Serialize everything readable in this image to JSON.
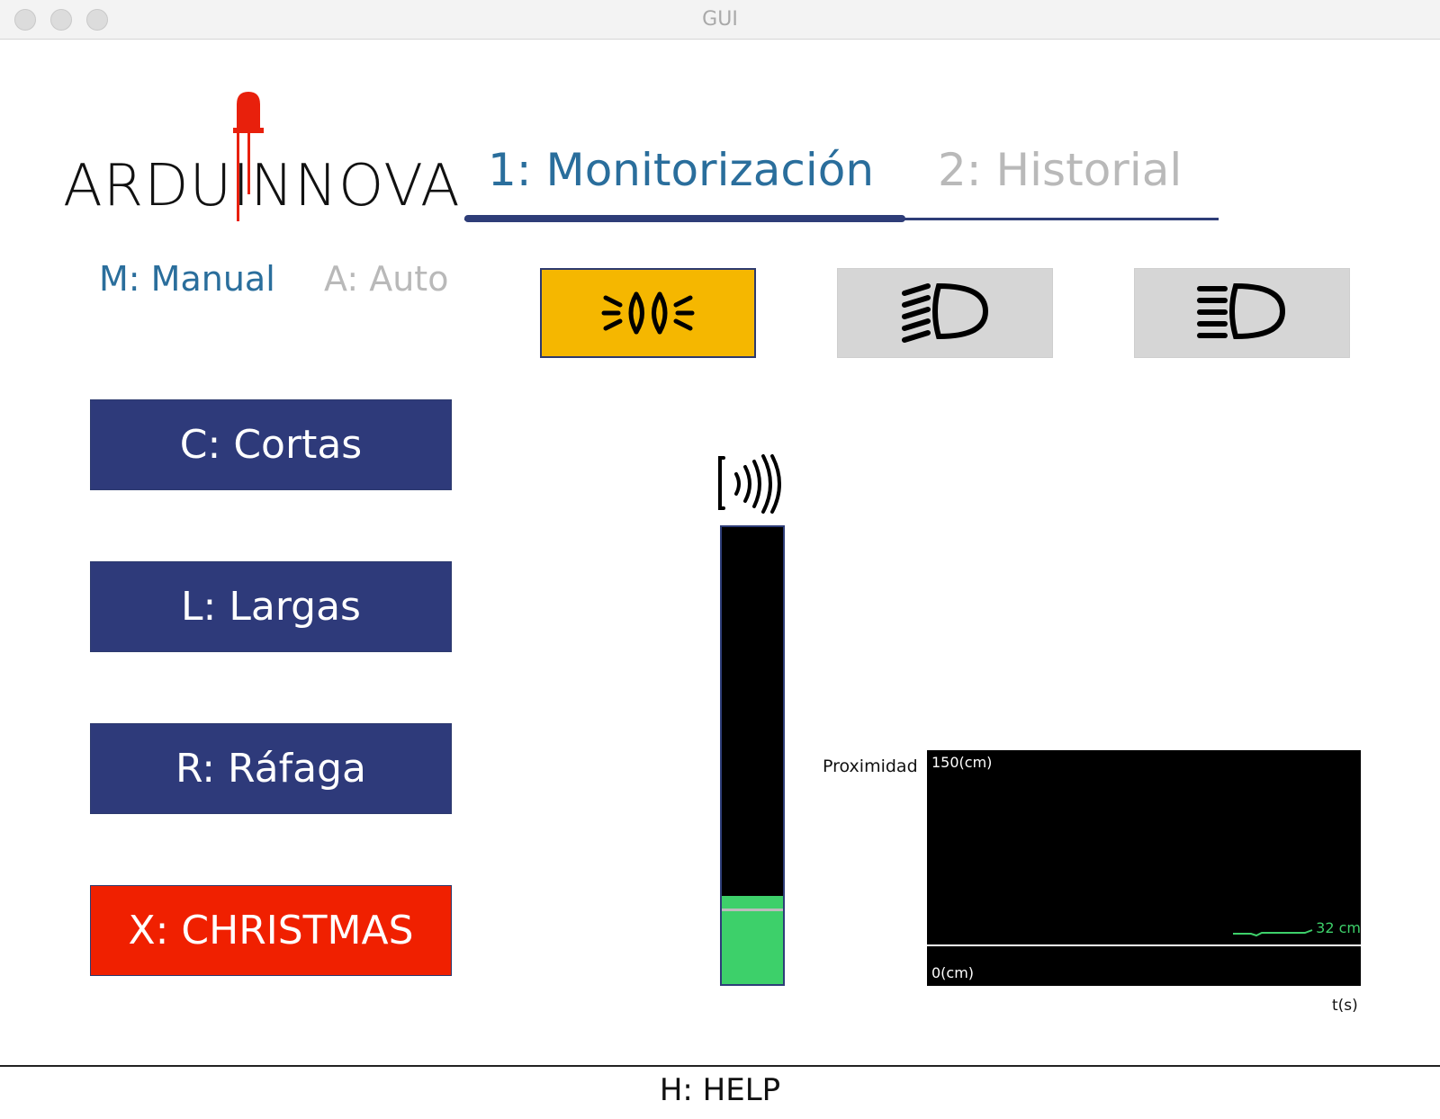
{
  "window": {
    "title": "GUI"
  },
  "logo": {
    "text": "ARDUINNOVA",
    "led_color": "#e8200c"
  },
  "tabs": [
    {
      "label": "1: Monitorización",
      "active": true
    },
    {
      "label": "2: Historial",
      "active": false
    }
  ],
  "modes": [
    {
      "label": "M: Manual",
      "active": true
    },
    {
      "label": "A: Auto",
      "active": false
    }
  ],
  "light_indicators": [
    {
      "icon": "parking-lights-icon",
      "active": true,
      "color": "#f5b700"
    },
    {
      "icon": "low-beam-icon",
      "active": false,
      "color": "#d6d6d6"
    },
    {
      "icon": "high-beam-icon",
      "active": false,
      "color": "#d6d6d6"
    }
  ],
  "buttons": [
    {
      "label": "C: Cortas",
      "color": "#2e3a7a"
    },
    {
      "label": "L: Largas",
      "color": "#2e3a7a"
    },
    {
      "label": "R: Ráfaga",
      "color": "#2e3a7a"
    },
    {
      "label": "X: CHRISTMAS",
      "color": "#f02000"
    }
  ],
  "proximity": {
    "label": "Proximidad",
    "max_label": "150(cm)",
    "min_label": "0(cm)",
    "current_label": "32 cm",
    "current_value": 32,
    "max_value": 150,
    "threshold_fraction": 0.16,
    "time_label": "t(s)"
  },
  "footer": {
    "help_label": "H: HELP"
  }
}
